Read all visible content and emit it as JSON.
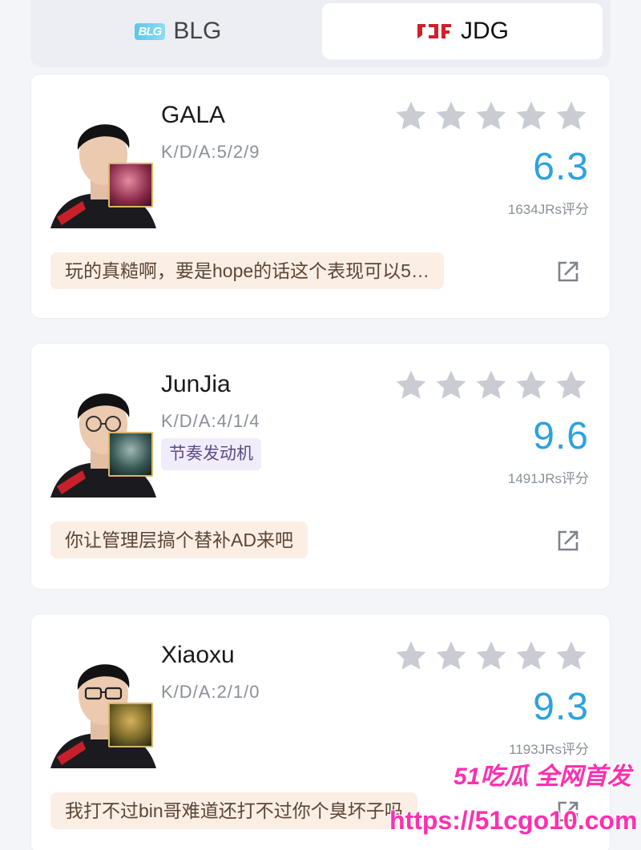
{
  "teams": [
    {
      "logo": "BLG",
      "name": "BLG",
      "selected": false
    },
    {
      "logo": "JDG",
      "name": "JDG",
      "selected": true
    }
  ],
  "players": [
    {
      "name": "GALA",
      "kda": "K/D/A:5/2/9",
      "tag": "",
      "score": "6.3",
      "rating_count": "1634JRs评分",
      "comment": "玩的真糙啊，要是hope的话这个表现可以5…",
      "champion_icon": "champion-icon",
      "champion_color": "#8a2b4a"
    },
    {
      "name": "JunJia",
      "kda": "K/D/A:4/1/4",
      "tag": "节奏发动机",
      "score": "9.6",
      "rating_count": "1491JRs评分",
      "comment": "你让管理层搞个替补AD来吧",
      "champion_icon": "champion-icon",
      "champion_color": "#3b5b58"
    },
    {
      "name": "Xiaoxu",
      "kda": "K/D/A:2/1/0",
      "tag": "",
      "score": "9.3",
      "rating_count": "1193JRs评分",
      "comment": "我打不过bin哥难道还打不过你个臭坏子吗",
      "champion_icon": "champion-icon",
      "champion_color": "#7a6a2a"
    }
  ],
  "watermark": {
    "title": "51吃瓜 全网首发",
    "url": "https://51cgo10.com"
  },
  "colors": {
    "score": "#2ba2e0",
    "star_empty": "#c9ccd3",
    "comment_bg": "#fbeee4",
    "watermark": "#ff2fb0"
  }
}
